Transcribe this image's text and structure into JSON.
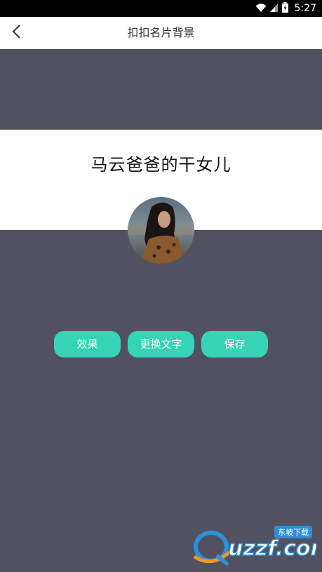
{
  "status_bar": {
    "time": "5:27",
    "icons": [
      "wifi-icon",
      "signal-icon",
      "battery-icon"
    ]
  },
  "header": {
    "back_icon": "chevron-left-icon",
    "title": "扣扣名片背景"
  },
  "card": {
    "name": "马云爸爸的干女儿"
  },
  "avatar": {
    "icon": "avatar-photo"
  },
  "actions": {
    "effect_label": "效果",
    "replace_text_label": "更换文字",
    "save_label": "保存"
  },
  "watermark": {
    "brand": "uzzf.com",
    "tagline": "东坡下载"
  },
  "colors": {
    "background": "#515160",
    "accent": "#35d4b5",
    "card": "#ffffff",
    "status_bar": "#000000"
  }
}
